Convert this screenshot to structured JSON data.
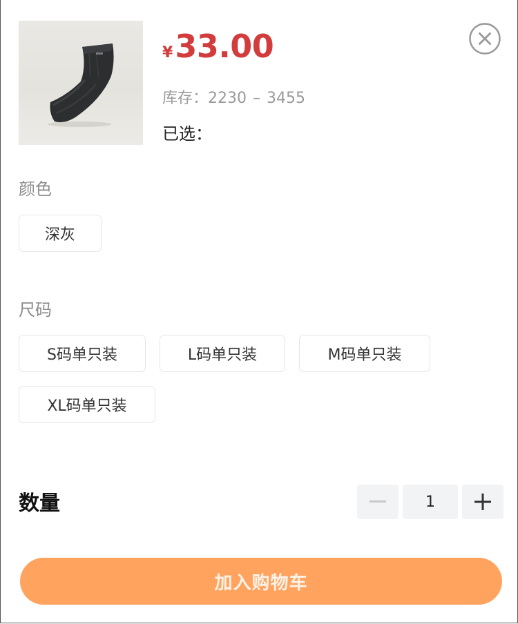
{
  "product": {
    "image_icon": "elbow-sleeve-product-image",
    "currency_symbol": "¥",
    "price": "33.00",
    "stock_label": "库存：",
    "stock_min": "2230",
    "stock_separator": "–",
    "stock_max": "3455",
    "selected_label": "已选："
  },
  "close": {
    "icon": "close-circle-icon"
  },
  "color_section": {
    "title": "颜色",
    "options": [
      "深灰"
    ]
  },
  "size_section": {
    "title": "尺码",
    "options": [
      "S码单只装",
      "L码单只装",
      "M码单只装",
      "XL码单只装"
    ]
  },
  "quantity": {
    "label": "数量",
    "value": "1",
    "minus_icon": "minus-icon",
    "plus_icon": "plus-icon"
  },
  "cart": {
    "button_label": "加入购物车"
  },
  "colors": {
    "price_red": "#d23c3c",
    "cart_orange": "#ffa35f",
    "stepper_bg": "#f2f3f5",
    "muted_text": "#9a9a9a"
  }
}
